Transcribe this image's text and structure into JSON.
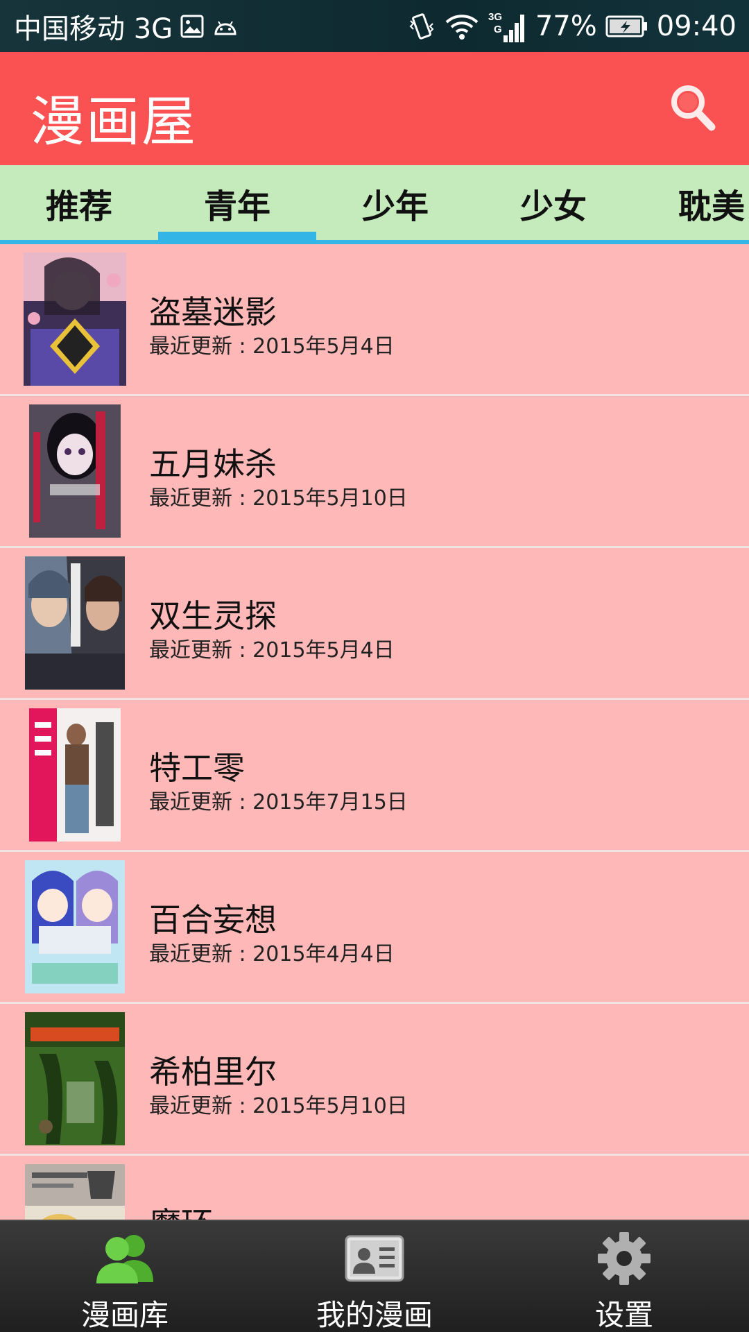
{
  "status_bar": {
    "carrier": "中国移动 3G",
    "network_label": "3G",
    "battery": "77%",
    "time": "09:40",
    "icons": [
      "image-icon",
      "android-icon",
      "vibrate-icon",
      "wifi-icon",
      "signal-icon",
      "battery-icon"
    ]
  },
  "app_bar": {
    "title": "漫画屋",
    "search_icon": "search-icon"
  },
  "tabs": {
    "items": [
      {
        "label": "推荐"
      },
      {
        "label": "青年"
      },
      {
        "label": "少年"
      },
      {
        "label": "少女"
      },
      {
        "label": "耽美"
      }
    ],
    "selected": "青年"
  },
  "list": {
    "items": [
      {
        "name": "盗墓迷影",
        "update": "最近更新 : 2015年5月4日"
      },
      {
        "name": "五月妹杀",
        "update": "最近更新 : 2015年5月10日"
      },
      {
        "name": "双生灵探",
        "update": "最近更新 : 2015年5月4日"
      },
      {
        "name": "特工零",
        "update": "最近更新 : 2015年7月15日"
      },
      {
        "name": "百合妄想",
        "update": "最近更新 : 2015年4月4日"
      },
      {
        "name": "希柏里尔",
        "update": "最近更新 : 2015年5月10日"
      },
      {
        "name": "魔环",
        "update": ""
      }
    ]
  },
  "bottom_nav": {
    "items": [
      {
        "label": "漫画库",
        "icon": "people-icon"
      },
      {
        "label": "我的漫画",
        "icon": "id-card-icon"
      },
      {
        "label": "设置",
        "icon": "gear-icon"
      }
    ]
  },
  "colors": {
    "app_bar": "#fa5252",
    "tab_bar": "#c5ebbd",
    "tab_indicator": "#33b5e5",
    "list_background": "#ffb8b8",
    "bottom_nav": "#2a2a2a",
    "people_icon": "#5cc43a"
  }
}
